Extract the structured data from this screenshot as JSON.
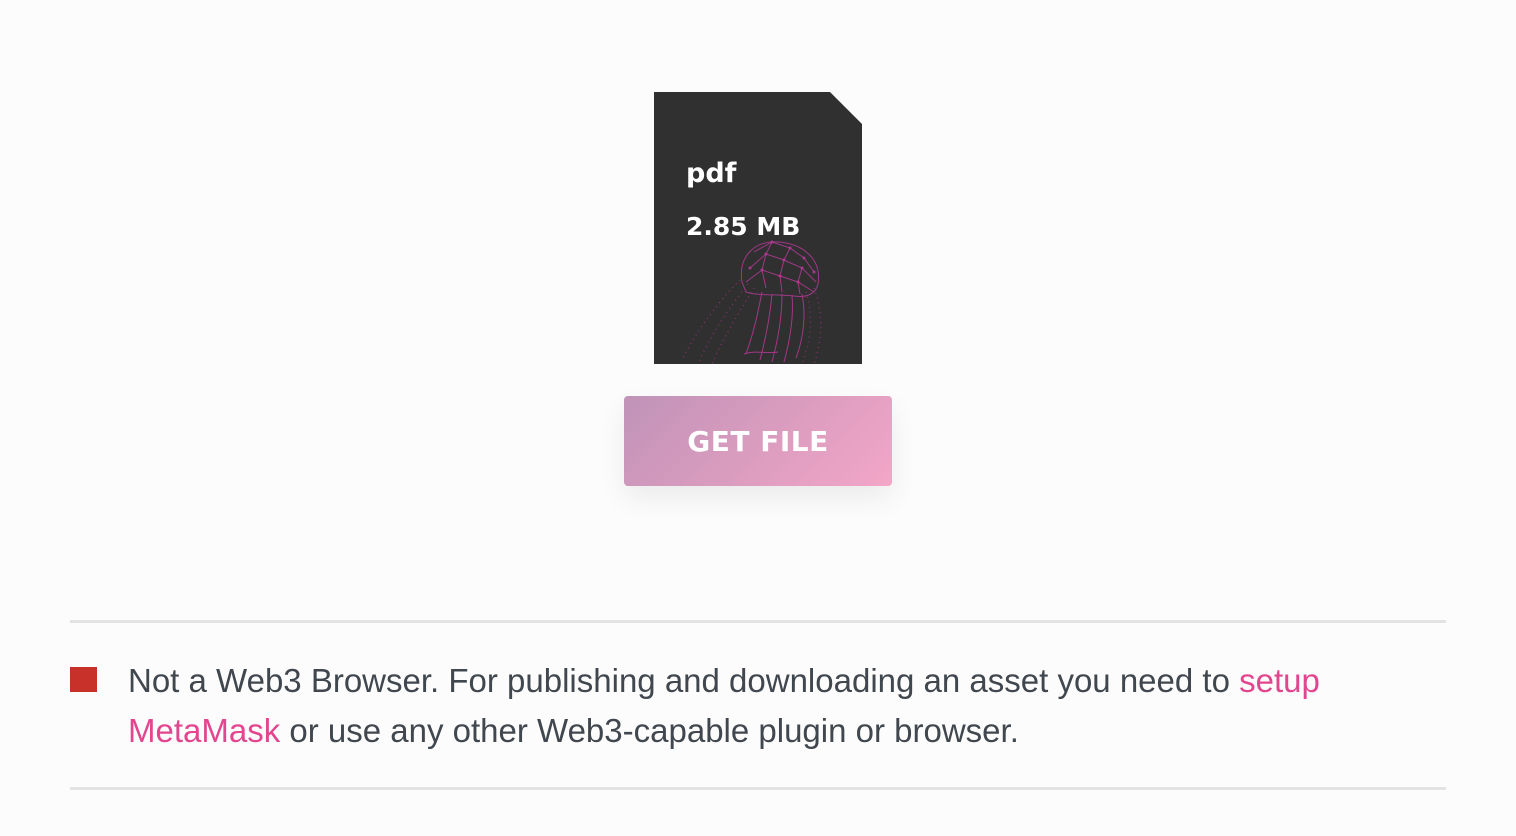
{
  "file": {
    "type": "pdf",
    "size": "2.85 MB",
    "card_color": "#303030",
    "illustration": "jellyfish-illustration"
  },
  "actions": {
    "get_file_label": "GET FILE"
  },
  "notice": {
    "indicator_color": "#c8302a",
    "text_before": "Not a Web3 Browser. For publishing and downloading an asset you need to ",
    "link_label": "setup MetaMask",
    "text_after": " or use any other Web3-capable plugin or browser.",
    "link_color": "#e2468e"
  }
}
